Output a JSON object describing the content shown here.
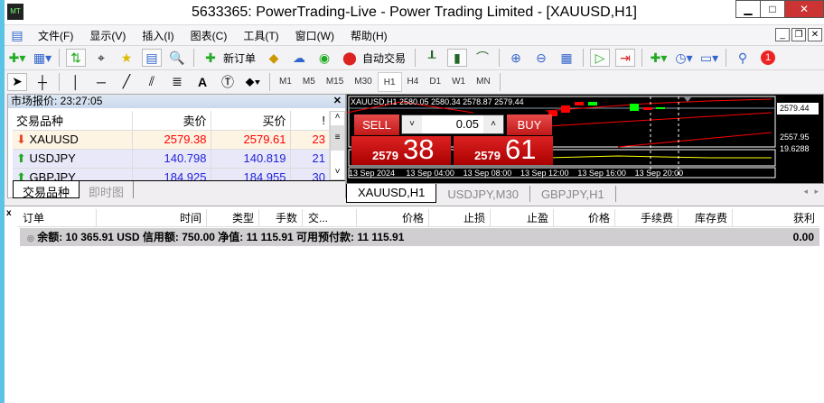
{
  "title": "5633365: PowerTrading-Live - Power Trading Limited - [XAUUSD,H1]",
  "menu": [
    "文件(F)",
    "显示(V)",
    "插入(I)",
    "图表(C)",
    "工具(T)",
    "窗口(W)",
    "帮助(H)"
  ],
  "toolbar": {
    "new_order": "新订单",
    "auto_trading": "自动交易",
    "notification_count": "1"
  },
  "timeframes": [
    "M1",
    "M5",
    "M15",
    "M30",
    "H1",
    "H4",
    "D1",
    "W1",
    "MN"
  ],
  "active_timeframe": "H1",
  "market_watch": {
    "title": "市场报价: 23:27:05",
    "headers": [
      "交易品种",
      "卖价",
      "买价",
      "!"
    ],
    "rows": [
      {
        "symbol": "XAUUSD",
        "bid": "2579.38",
        "ask": "2579.61",
        "spread": "23",
        "dir": "down"
      },
      {
        "symbol": "USDJPY",
        "bid": "140.798",
        "ask": "140.819",
        "spread": "21",
        "dir": "up"
      },
      {
        "symbol": "GBPJPY",
        "bid": "184.925",
        "ask": "184.955",
        "spread": "30",
        "dir": "up"
      }
    ],
    "tabs": [
      "交易品种",
      "即时图"
    ]
  },
  "chart": {
    "header": "XAUUSD,H1  2580.05 2580.34 2578.87 2579.44",
    "price_current": "2579.44",
    "price_low": "2557.95",
    "indicator_value": "19.6288",
    "time_labels": [
      "13 Sep 2024",
      "13 Sep 04:00",
      "13 Sep 08:00",
      "13 Sep 12:00",
      "13 Sep 16:00",
      "13 Sep 20:00"
    ],
    "one_click": {
      "sell": "SELL",
      "buy": "BUY",
      "lot": "0.05",
      "sell_big": "2579",
      "sell_small": "38",
      "buy_big": "2579",
      "buy_small": "61"
    },
    "colors": {
      "bull": "#00ff00",
      "bear": "#ff0000",
      "indicator": "#ffff00"
    }
  },
  "chart_tabs": [
    "XAUUSD,H1",
    "USDJPY,M30",
    "GBPJPY,H1"
  ],
  "terminal": {
    "headers": [
      "订单",
      "时间",
      "类型",
      "手数",
      "交...",
      "价格",
      "止损",
      "止盈",
      "价格",
      "手续费",
      "库存费",
      "获利"
    ],
    "balance_line": "余额: 10 365.91 USD  信用额: 750.00  净值: 11 115.91  可用预付款: 11 115.91",
    "profit": "0.00"
  }
}
